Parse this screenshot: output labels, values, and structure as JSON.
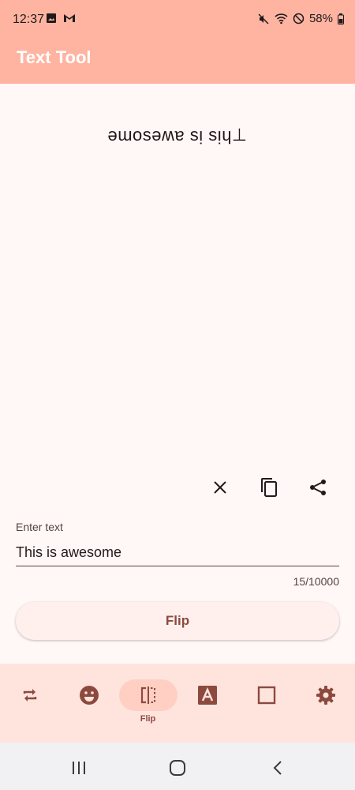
{
  "status": {
    "time": "12:37",
    "battery": "58%"
  },
  "app": {
    "title": "Text Tool"
  },
  "output": {
    "text": "ǝɯosǝʍɐ sᴉ sᴉɥ⊥"
  },
  "input": {
    "label": "Enter text",
    "value": "This is awesome",
    "counter": "15/10000"
  },
  "actions": {
    "flip_label": "Flip"
  },
  "bottom_nav": {
    "active_label": "Flip"
  },
  "colors": {
    "accent": "#ffb4a2",
    "icon": "#8c4a3f"
  }
}
